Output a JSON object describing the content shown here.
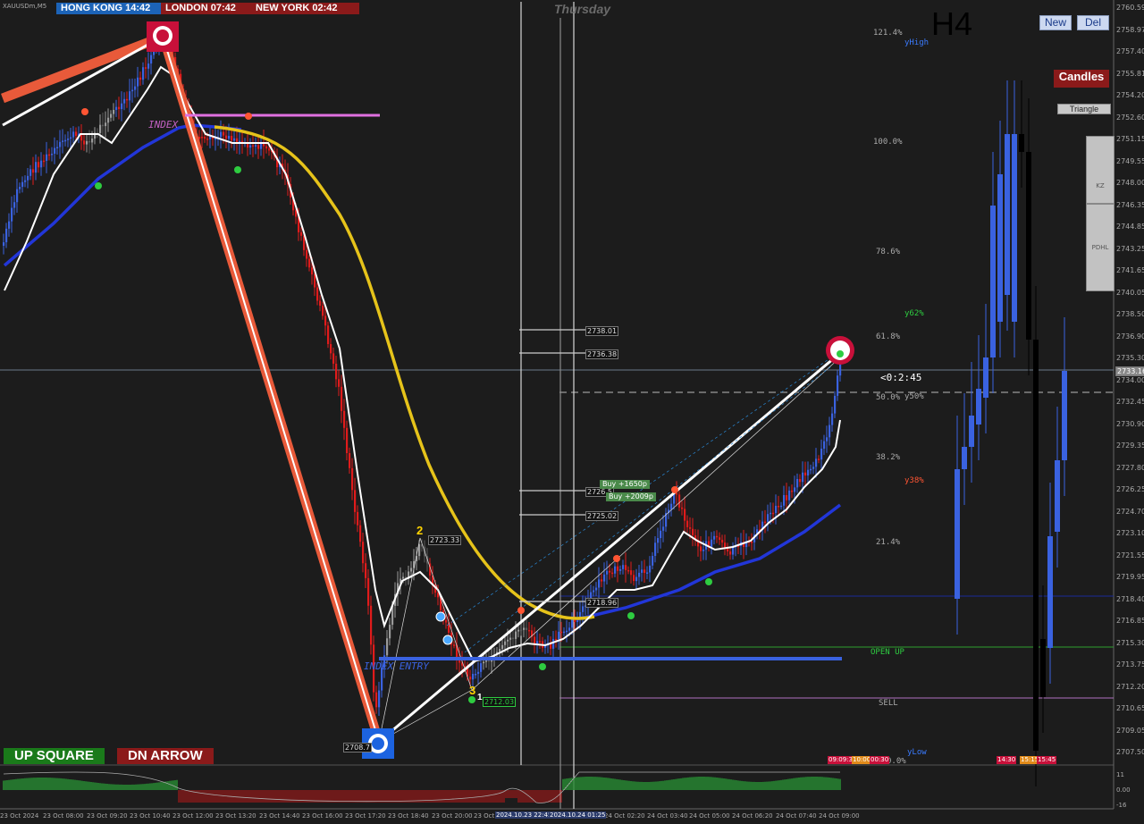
{
  "symbol": "XAUUSDm,M5",
  "sessions": [
    {
      "label": "HONG KONG 14:42",
      "color": "#1c63b7"
    },
    {
      "label": "LONDON  07:42",
      "color": "#8b1a1a"
    },
    {
      "label": "NEW YORK  02:42",
      "color": "#8b1a1a"
    }
  ],
  "day_label": "Thursday",
  "timeframe": "H4",
  "buttons": {
    "new": "New",
    "del": "Del",
    "candles": "Candles",
    "triangle": "Triangle",
    "panel_top": "KZ",
    "panel_bottom": "PDHL"
  },
  "bottom_buttons": {
    "up": "UP SQUARE",
    "dn": "DN ARROW"
  },
  "index_labels": {
    "index_top": "INDEX",
    "index_entry": "INDEX ENTRY"
  },
  "fib_levels": [
    {
      "label": "121.4%"
    },
    {
      "label": "yHigh"
    },
    {
      "label": "100.0%"
    },
    {
      "label": "78.6%"
    },
    {
      "label": "y62%"
    },
    {
      "label": "61.8%"
    },
    {
      "label": "50.0%"
    },
    {
      "label": "y50%"
    },
    {
      "label": "38.2%"
    },
    {
      "label": "y38%"
    },
    {
      "label": "21.4%"
    },
    {
      "label": "OPEN UP"
    },
    {
      "label": "SELL"
    },
    {
      "label": "yLow"
    },
    {
      "label": "0.0%"
    }
  ],
  "countdown": "<0:2:45",
  "price_tags": [
    "2738.01",
    "2736.38",
    "2726.5",
    "2725.02",
    "2718.96",
    "2723.33",
    "2708.7",
    "2712.03",
    "2733.16"
  ],
  "buy_tags": [
    "Buy +1650p",
    "Buy +2009p"
  ],
  "wave_numbers": [
    "2",
    "3",
    "1"
  ],
  "small_tags": [
    "09:09:30",
    "10:00",
    "00:30",
    "14:30",
    "15:15",
    "15:45"
  ],
  "price_axis": [
    "2760.59",
    "2758.97",
    "2757.40",
    "2755.81",
    "2754.20",
    "2752.60",
    "2751.15",
    "2749.55",
    "2748.00",
    "2746.35",
    "2744.85",
    "2743.25",
    "2741.65",
    "2740.05",
    "2738.50",
    "2736.90",
    "2735.30",
    "2734.00",
    "2732.45",
    "2730.90",
    "2729.35",
    "2727.80",
    "2726.25",
    "2724.70",
    "2723.10",
    "2721.55",
    "2719.95",
    "2718.40",
    "2716.85",
    "2715.30",
    "2713.75",
    "2712.20",
    "2710.65",
    "2709.05",
    "2707.50"
  ],
  "current_price": "2733.16",
  "osc_axis": [
    "11",
    "0.00",
    "-16"
  ],
  "time_axis": [
    "23 Oct 2024",
    "23 Oct 08:00",
    "23 Oct 09:20",
    "23 Oct 10:40",
    "23 Oct 12:00",
    "23 Oct 13:20",
    "23 Oct 14:40",
    "23 Oct 16:00",
    "23 Oct 17:20",
    "23 Oct 18:40",
    "23 Oct 20:00",
    "23 Oct",
    "24 Oct 02:20",
    "24 Oct 03:40",
    "24 Oct 05:00",
    "24 Oct 06:20",
    "24 Oct 07:40",
    "24 Oct 09:00"
  ],
  "date_boxes": [
    "2024.10.23 22:45",
    "2024.10.24 01:25"
  ],
  "colors": {
    "bull": "#3a62e0",
    "bear": "#e01b1b",
    "ma_blue": "#2236d8",
    "ma_yellow": "#e6c31a",
    "ma_white": "#ffffff",
    "trend_orange": "#e85a3a"
  }
}
